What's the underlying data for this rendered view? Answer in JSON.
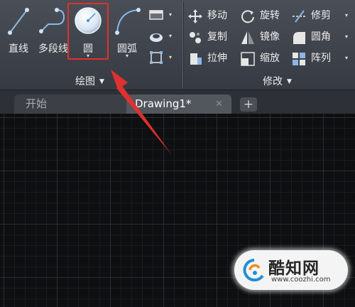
{
  "ribbon": {
    "draw_group": {
      "label": "绘图",
      "tools": {
        "line": "直线",
        "polyline": "多段线",
        "circle": "圆",
        "arc": "圆弧"
      },
      "dropdown_glyph": "▾",
      "small_arrow": "▾"
    },
    "modify_group": {
      "label": "修改",
      "tools": {
        "move": "移动",
        "rotate": "旋转",
        "trim": "修剪",
        "copy": "复制",
        "mirror": "镜像",
        "fillet": "圆角",
        "stretch": "拉伸",
        "scale": "缩放",
        "array": "阵列"
      },
      "arrow": "▾"
    },
    "group_expand_glyph": "▼"
  },
  "tabs": {
    "start": "开始",
    "drawing": "Drawing1*",
    "close_glyph": "✕",
    "new_tab_glyph": "+"
  },
  "watermark": {
    "name": "酷知网",
    "url": "www.coozhi.com"
  },
  "colors": {
    "ribbon_bg": "#3c4048",
    "canvas_bg": "#0e0f10",
    "highlight": "#e03030",
    "icon_blue": "#6fa8dc"
  }
}
